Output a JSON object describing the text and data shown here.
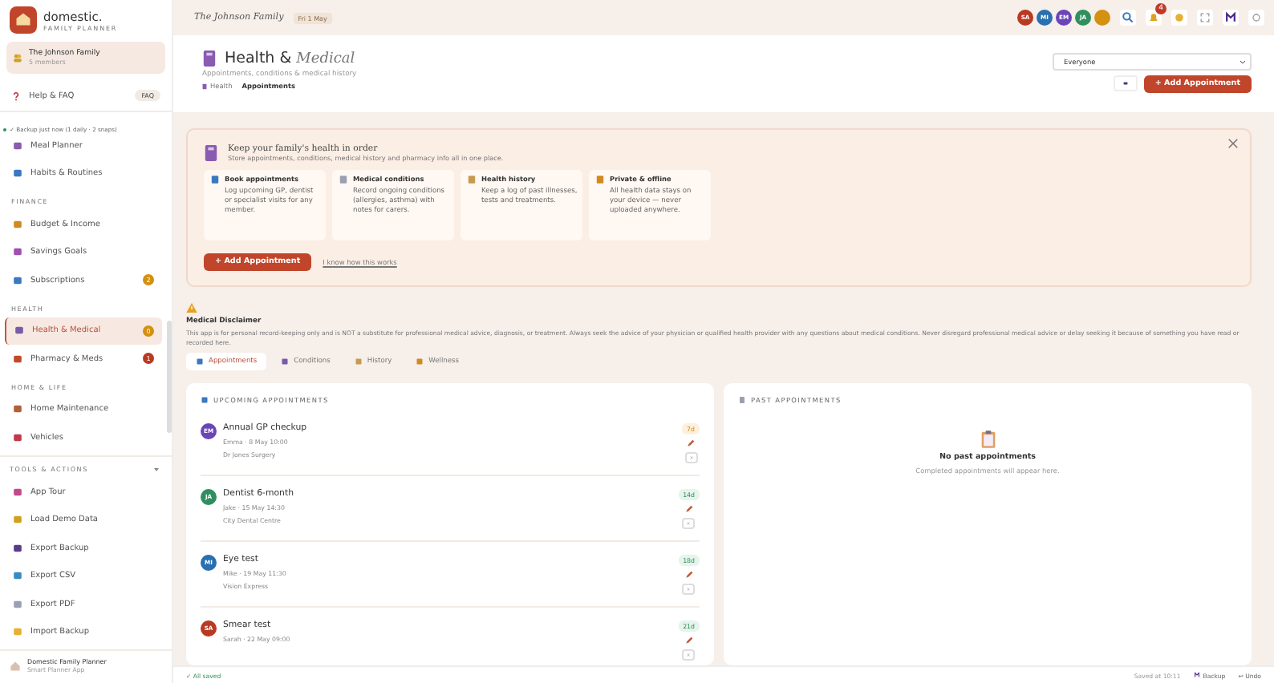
{
  "brand": {
    "name": "domestic.",
    "tagline": "FAMILY PLANNER"
  },
  "family": {
    "name": "The Johnson Family",
    "members": "5 members"
  },
  "help": {
    "label": "Help & FAQ",
    "badge": "FAQ"
  },
  "backup_status": "✓ Backup just now (1 daily · 2 snaps)",
  "nav": [
    {
      "kind": "item",
      "label": "Meal Planner",
      "selected": false
    },
    {
      "kind": "item",
      "label": "Habits & Routines",
      "selected": false
    },
    {
      "kind": "header",
      "label": "FINANCE"
    },
    {
      "kind": "item",
      "label": "Budget & Income",
      "selected": false
    },
    {
      "kind": "item",
      "label": "Savings Goals",
      "selected": false
    },
    {
      "kind": "item",
      "label": "Subscriptions",
      "selected": false,
      "badge": "2",
      "color": "#d4900f"
    },
    {
      "kind": "header",
      "label": "HEALTH"
    },
    {
      "kind": "item",
      "label": "Health & Medical",
      "selected": true,
      "badge": "0",
      "color": "#d4900f"
    },
    {
      "kind": "item",
      "label": "Pharmacy & Meds",
      "selected": false,
      "badge": "1",
      "color": "#b83a22"
    },
    {
      "kind": "header",
      "label": "HOME & LIFE"
    },
    {
      "kind": "item",
      "label": "Home Maintenance",
      "selected": false
    },
    {
      "kind": "item",
      "label": "Vehicles",
      "selected": false
    }
  ],
  "tools": {
    "title": "TOOLS & ACTIONS",
    "expanded": true,
    "items": [
      {
        "label": "App Tour"
      },
      {
        "label": "Load Demo Data"
      },
      {
        "label": "Export Backup"
      },
      {
        "label": "Export CSV"
      },
      {
        "label": "Export PDF"
      },
      {
        "label": "Import Backup"
      }
    ]
  },
  "footer": {
    "title": "Domestic Family Planner",
    "subtitle": "Smart Planner App"
  },
  "topbar": {
    "family": "The Johnson Family",
    "date": "Fri 1 May",
    "avatars": [
      {
        "initials": "SA",
        "color": "#b83a22"
      },
      {
        "initials": "MI",
        "color": "#2a6fb0"
      },
      {
        "initials": "EM",
        "color": "#6b45b8"
      },
      {
        "initials": "JA",
        "color": "#2f8f5e"
      },
      {
        "color": "#d4900f"
      }
    ],
    "notifications": "4"
  },
  "page": {
    "title": "Health &",
    "title_italic": "Medical",
    "subtitle": "Appointments, conditions & medical history",
    "breadcrumb": [
      "Health",
      "Appointments"
    ],
    "filter": "Everyone",
    "add_button": "+ Add Appointment"
  },
  "intro": {
    "title": "Keep your family's health in order",
    "subtitle": "Store appointments, conditions, medical history and pharmacy info all in one place.",
    "cards": [
      {
        "title": "Book appointments",
        "text": "Log upcoming GP, dentist or specialist visits for any member."
      },
      {
        "title": "Medical conditions",
        "text": "Record ongoing conditions (allergies, asthma) with notes for carers."
      },
      {
        "title": "Health history",
        "text": "Keep a log of past illnesses, tests and treatments."
      },
      {
        "title": "Private & offline",
        "text": "All health data stays on your device — never uploaded anywhere."
      }
    ],
    "button": "+ Add Appointment",
    "link": "I know how this works"
  },
  "disclaimer": {
    "title": "Medical Disclaimer",
    "text": "This app is for personal record-keeping only and is NOT a substitute for professional medical advice, diagnosis, or treatment. Always seek the advice of your physician or qualified health provider with any questions about medical conditions. Never disregard professional medical advice or delay seeking it because of something you have read or recorded here."
  },
  "tabs": [
    {
      "label": "Appointments",
      "selected": true
    },
    {
      "label": "Conditions",
      "selected": false
    },
    {
      "label": "History",
      "selected": false
    },
    {
      "label": "Wellness",
      "selected": false
    }
  ],
  "upcoming": {
    "title": "UPCOMING APPOINTMENTS",
    "rows": [
      {
        "initials": "EM",
        "color": "#6b45b8",
        "title": "Annual GP checkup",
        "meta": "Emma · 8 May 10:00",
        "place": "Dr Jones Surgery",
        "due": "7d",
        "urgent": true
      },
      {
        "initials": "JA",
        "color": "#2f8f5e",
        "title": "Dentist 6-month",
        "meta": "Jake · 15 May 14:30",
        "place": "City Dental Centre",
        "due": "14d",
        "urgent": false
      },
      {
        "initials": "MI",
        "color": "#2a6fb0",
        "title": "Eye test",
        "meta": "Mike · 19 May 11:30",
        "place": "Vision Express",
        "due": "18d",
        "urgent": false
      },
      {
        "initials": "SA",
        "color": "#b83a22",
        "title": "Smear test",
        "meta": "Sarah · 22 May 09:00",
        "due": "21d",
        "urgent": false
      }
    ]
  },
  "past": {
    "title": "PAST APPOINTMENTS",
    "empty_title": "No past appointments",
    "empty_text": "Completed appointments will appear here."
  },
  "status_bar": {
    "left": "✓ All saved",
    "saved": "Saved at 10:11",
    "backup": "Backup",
    "undo": "↩ Undo"
  }
}
